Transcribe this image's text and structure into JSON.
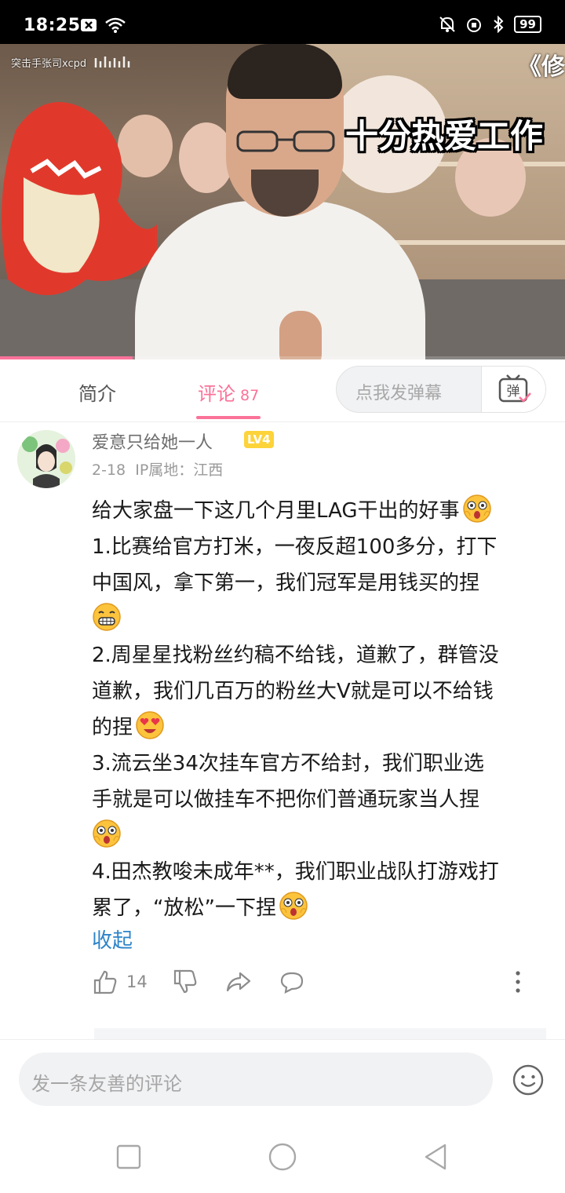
{
  "status_bar": {
    "time": "18:25",
    "battery": "99"
  },
  "video": {
    "watermark": "突击手张司xcpd",
    "corner_text": "《修",
    "caption": "十分热爱工作",
    "progress_fraction": 0.235
  },
  "tabs": {
    "intro_label": "简介",
    "comments_label": "评论",
    "comments_count": "87",
    "danmaku_placeholder": "点我发弹幕",
    "danmaku_button_label": "弹"
  },
  "comment": {
    "username": "爱意只给她一人",
    "level": "LV4",
    "date": "2-18",
    "ip_location": "IP属地：江西",
    "lines": [
      "给大家盘一下这几个月里LAG干出的好事",
      "1.比赛给官方打米，一夜反超100多分，打下",
      "中国风，拿下第一，我们冠军是用钱买的捏",
      "",
      "2.周星星找粉丝约稿不给钱，道歉了，群管没",
      "道歉，我们几百万的粉丝大V就是可以不给钱",
      "的捏",
      "3.流云坐34次挂车官方不给封，我们职业选",
      "手就是可以做挂车不把你们普通玩家当人捏",
      "",
      "4.田杰教唆未成年**，我们职业战队打游戏打",
      "累了，“放松”一下捏"
    ],
    "collapse_label": "收起",
    "like_count": "14"
  },
  "input_bar": {
    "placeholder": "发一条友善的评论"
  },
  "colors": {
    "accent": "#fb7299",
    "link": "#2e84c8",
    "level_badge": "#fdd33a"
  }
}
